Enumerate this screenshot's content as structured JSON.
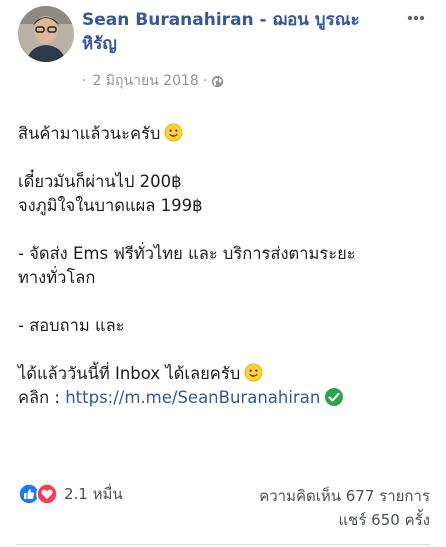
{
  "post": {
    "author_name": "Sean Buranahiran - ฌอน บูรณะหิรัญ",
    "date": "2 มิถุนายน 2018",
    "meta_dot": "·",
    "meta_sep": "·",
    "privacy_icon": "globe-icon",
    "more_icon": "more-dots-icon",
    "body": {
      "line1": "สินค้ามาแล้วนะครับ",
      "line2": "เดี๋ยวมันก็ผ่านไป 200฿",
      "line3": "จงภูมิใจในบาดแผล 199฿",
      "line4": "- จัดส่ง Ems ฟรีทั่วไทย และ บริการส่งตามระยะ",
      "line5": "ทางทั่วโลก",
      "line6": "- สอบถาม และ",
      "line7": "ได้แล้ววันนี้ที่ Inbox ได้เลยครับ",
      "click_label": "คลิก : ",
      "link_text": "https://m.me/SeanBuranahiran"
    },
    "reactions": {
      "icons": [
        "like-icon",
        "love-icon"
      ],
      "count": "2.1 หมื่น"
    },
    "comments": "ความคิดเห็น 677 รายการ",
    "shares": "แชร์ 650 ครั้ง"
  },
  "colors": {
    "author": "#385898",
    "link": "#365899",
    "meta": "#90949c",
    "like": "#2078f4",
    "love": "#f33e58",
    "verified": "#31a24c"
  }
}
